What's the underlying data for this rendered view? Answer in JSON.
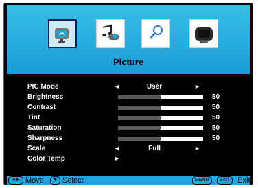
{
  "menu": {
    "icons": [
      "picture-icon",
      "audio-icon",
      "search-icon",
      "tv-icon"
    ],
    "selected_index": 0,
    "section_title": "Picture"
  },
  "settings": {
    "pic_mode": {
      "label": "PIC Mode",
      "value": "User"
    },
    "brightness": {
      "label": "Brightness",
      "value": 50
    },
    "contrast": {
      "label": "Contrast",
      "value": 50
    },
    "tint": {
      "label": "Tint",
      "value": 50
    },
    "saturation": {
      "label": "Saturation",
      "value": 50
    },
    "sharpness": {
      "label": "Sharpness",
      "value": 50
    },
    "scale": {
      "label": "Scale",
      "value": "Full"
    },
    "color_temp": {
      "label": "Color Temp"
    }
  },
  "footer": {
    "move_label": "Move",
    "select_label": "Select",
    "menu_key": "MENU",
    "exit_key": "EXIT",
    "exit_label": "Exit"
  },
  "colors": {
    "band": "#1fa6de",
    "selected_border": "#0d1c5e",
    "bar_fill": "#5a5a5a"
  }
}
